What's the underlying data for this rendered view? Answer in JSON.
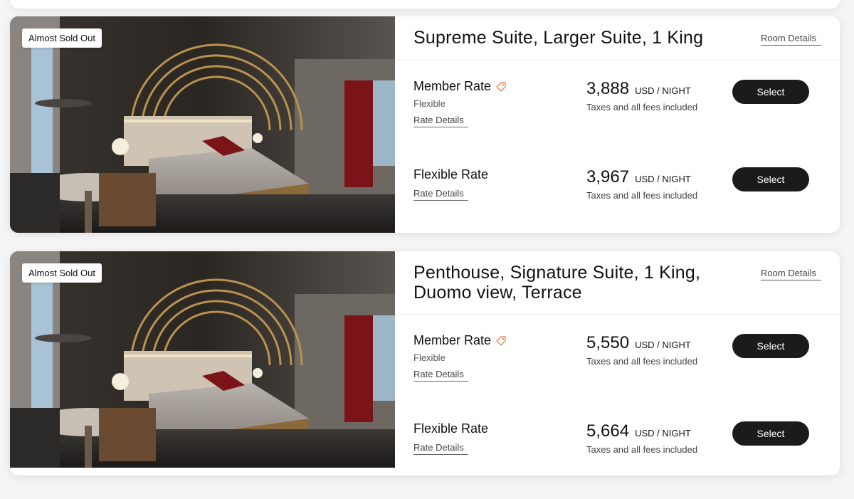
{
  "rooms": [
    {
      "badge": "Almost Sold Out",
      "title": "Supreme Suite, Larger Suite, 1 King",
      "room_details_label": "Room Details",
      "rates": [
        {
          "name": "Member Rate",
          "icon": "price-tag-icon",
          "subtitle": "Flexible",
          "details_label": "Rate Details",
          "amount": "3,888",
          "unit": "USD / NIGHT",
          "note": "Taxes and all fees included",
          "button_label": "Select"
        },
        {
          "name": "Flexible Rate",
          "details_label": "Rate Details",
          "amount": "3,967",
          "unit": "USD / NIGHT",
          "note": "Taxes and all fees included",
          "button_label": "Select"
        }
      ]
    },
    {
      "badge": "Almost Sold Out",
      "title": "Penthouse, Signature Suite, 1 King, Duomo view, Terrace",
      "room_details_label": "Room Details",
      "rates": [
        {
          "name": "Member Rate",
          "icon": "price-tag-icon",
          "subtitle": "Flexible",
          "details_label": "Rate Details",
          "amount": "5,550",
          "unit": "USD / NIGHT",
          "note": "Taxes and all fees included",
          "button_label": "Select"
        },
        {
          "name": "Flexible Rate",
          "details_label": "Rate Details",
          "amount": "5,664",
          "unit": "USD / NIGHT",
          "note": "Taxes and all fees included",
          "button_label": "Select"
        }
      ]
    }
  ],
  "colors": {
    "button_bg": "#1b1b1b",
    "tag_icon": "#e8875a",
    "badge_bg": "#ffffff"
  }
}
